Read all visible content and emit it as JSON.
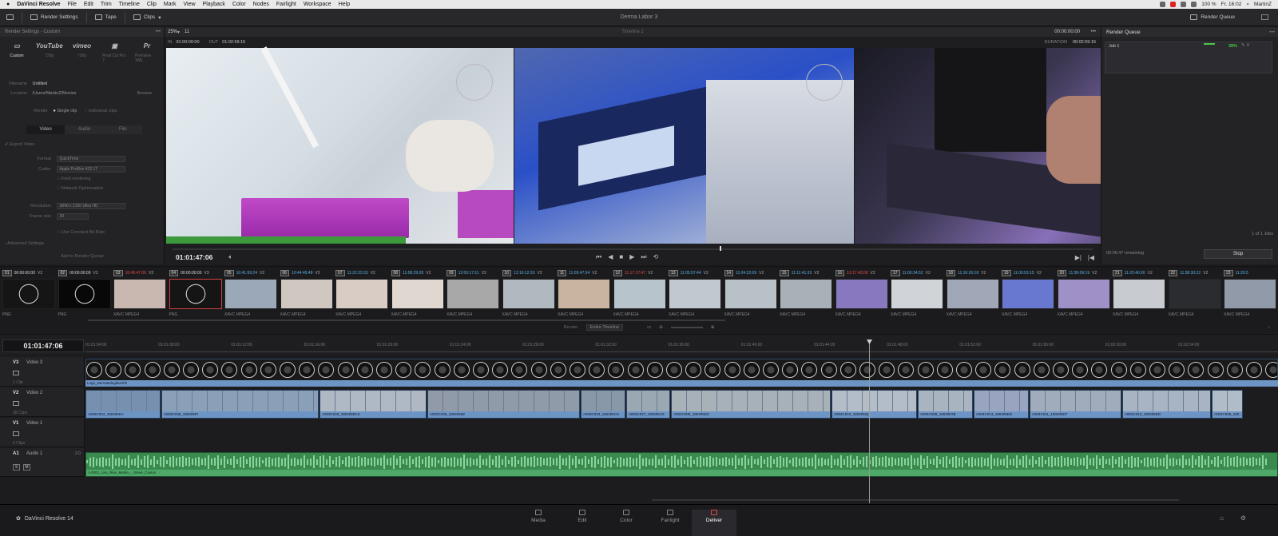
{
  "menubar": {
    "app": "DaVinci Resolve",
    "items": [
      "File",
      "Edit",
      "Trim",
      "Timeline",
      "Clip",
      "Mark",
      "View",
      "Playback",
      "Color",
      "Nodes",
      "Fairlight",
      "Workspace",
      "Help"
    ],
    "battery": "100 %",
    "clock": "Fr. 16:02",
    "user": "MartinZ"
  },
  "toolbar": {
    "render_settings": "Render Settings",
    "tape": "Tape",
    "clips": "Clips",
    "project_title": "Derma Labor 3",
    "render_queue": "Render Queue"
  },
  "render_settings": {
    "header": "Render Settings - Custom",
    "presets": [
      {
        "icon": "film-icon",
        "label": "Custom"
      },
      {
        "icon": "youtube-logo",
        "text": "YouTube",
        "label": "720p"
      },
      {
        "icon": "vimeo-logo",
        "text": "vimeo",
        "label": "720p"
      },
      {
        "icon": "clapper-icon",
        "label": "Final Cut Pro 7"
      },
      {
        "icon": "premiere-icon",
        "text": "Pr",
        "label": "Premiere XML"
      }
    ],
    "filename_label": "Filename",
    "filename": "Untitled",
    "location_label": "Location",
    "location": "/Users/MartinZ/Movies",
    "browse": "Browse",
    "render_label": "Render",
    "single_clip": "Single clip",
    "individual_clips": "Individual clips",
    "tabs": [
      "Video",
      "Audio",
      "File"
    ],
    "export_video": "Export Video",
    "format_label": "Format",
    "format": "QuickTime",
    "codec_label": "Codec",
    "codec": "Apple ProRes 422 LT",
    "field_rendering": "Field rendering",
    "network_opt": "Network Optimization",
    "resolution_label": "Resolution",
    "resolution": "3840 x 2160 Ultra HD",
    "framerate_label": "Frame rate",
    "framerate": "30",
    "bit_rate": "Use Constant Bit Rate",
    "advanced": "Advanced Settings",
    "add_queue": "Add to Render Queue"
  },
  "viewer": {
    "zoom": "25%",
    "clip_number": "11",
    "timeline_name": "Timeline 1",
    "header_tc": "00:00:00:00",
    "in_label": "IN",
    "in_tc": "01:00:00:00",
    "out_label": "OUT",
    "out_tc": "01:02:59:15",
    "duration_label": "DURATION",
    "duration": "00:02:59:16",
    "timecode": "01:01:47:06"
  },
  "render_queue": {
    "title": "Render Queue",
    "job": "Job 1",
    "progress_pct": "39%",
    "jobs_count": "1 of 1 Jobs",
    "remaining": "00:06:47 remaining",
    "stop": "Stop"
  },
  "clips": [
    {
      "num": "01",
      "tc": "00:00:00:00",
      "tc_color": "wh",
      "track": "V2",
      "codec": "PNG",
      "color": "#151515"
    },
    {
      "num": "02",
      "tc": "00:00:00:00",
      "tc_color": "wh",
      "track": "V2",
      "codec": "PNG",
      "color": "#080808"
    },
    {
      "num": "03",
      "tc": "10:45:47:06",
      "tc_color": "red",
      "track": "V2",
      "codec": "XAVC MPEG4",
      "color": "#c8b8b0"
    },
    {
      "num": "04",
      "tc": "00:00:00:00",
      "tc_color": "wh",
      "track": "V3",
      "codec": "PNG",
      "color": "#151515"
    },
    {
      "num": "05",
      "tc": "10:41:59:24",
      "tc_color": "bl",
      "track": "V2",
      "codec": "XAVC MPEG4",
      "color": "#9aa8b8"
    },
    {
      "num": "06",
      "tc": "10:44:49:48",
      "tc_color": "bl",
      "track": "V2",
      "codec": "XAVC MPEG4",
      "color": "#d0c8c0"
    },
    {
      "num": "07",
      "tc": "11:22:23:33",
      "tc_color": "bl",
      "track": "V2",
      "codec": "XAVC MPEG4",
      "color": "#d8ccc4"
    },
    {
      "num": "08",
      "tc": "11:58:29:28",
      "tc_color": "bl",
      "track": "V2",
      "codec": "XAVC MPEG4",
      "color": "#e0d8d0"
    },
    {
      "num": "09",
      "tc": "12:00:17:11",
      "tc_color": "bl",
      "track": "V2",
      "codec": "XAVC MPEG4",
      "color": "#a8a8a8"
    },
    {
      "num": "10",
      "tc": "12:16:12:33",
      "tc_color": "bl",
      "track": "V2",
      "codec": "XAVC MPEG4",
      "color": "#b0b8c0"
    },
    {
      "num": "11",
      "tc": "11:05:47:34",
      "tc_color": "bl",
      "track": "V2",
      "codec": "XAVC MPEG4",
      "color": "#c8b4a0"
    },
    {
      "num": "12",
      "tc": "11:17:17:47",
      "tc_color": "red",
      "track": "V2",
      "codec": "XAVC MPEG4",
      "color": "#b8c4cc"
    },
    {
      "num": "13",
      "tc": "11:05:57:44",
      "tc_color": "bl",
      "track": "V2",
      "codec": "XAVC MPEG4",
      "color": "#c0c8d0"
    },
    {
      "num": "14",
      "tc": "11:04:22:09",
      "tc_color": "bl",
      "track": "V2",
      "codec": "XAVC MPEG4",
      "color": "#b8c0c8"
    },
    {
      "num": "15",
      "tc": "11:11:41:33",
      "tc_color": "bl",
      "track": "V2",
      "codec": "XAVC MPEG4",
      "color": "#a8b0b8"
    },
    {
      "num": "16",
      "tc": "13:17:43:08",
      "tc_color": "red",
      "track": "V2",
      "codec": "XAVC MPEG4",
      "color": "#8878c0"
    },
    {
      "num": "17",
      "tc": "11:00:34:52",
      "tc_color": "bl",
      "track": "V2",
      "codec": "XAVC MPEG4",
      "color": "#d0d4d8"
    },
    {
      "num": "18",
      "tc": "11:16:26:18",
      "tc_color": "bl",
      "track": "V2",
      "codec": "XAVC MPEG4",
      "color": "#a0a8b8"
    },
    {
      "num": "19",
      "tc": "11:00:53:15",
      "tc_color": "bl",
      "track": "V2",
      "codec": "XAVC MPEG4",
      "color": "#6878d0"
    },
    {
      "num": "20",
      "tc": "11:38:09:19",
      "tc_color": "bl",
      "track": "V2",
      "codec": "XAVC MPEG4",
      "color": "#a090c8"
    },
    {
      "num": "21",
      "tc": "11:25:40:26",
      "tc_color": "bl",
      "track": "V2",
      "codec": "XAVC MPEG4",
      "color": "#c8ccd0"
    },
    {
      "num": "22",
      "tc": "11:38:30:22",
      "tc_color": "bl",
      "track": "V2",
      "codec": "XAVC MPEG4",
      "color": "#2a2c30"
    },
    {
      "num": "23",
      "tc": "11:29:5",
      "tc_color": "bl",
      "track": "",
      "codec": "XAVC MPEG4",
      "color": "#909aa8"
    }
  ],
  "timeline_bar": {
    "render_label": "Render",
    "render_value": "Entire Timeline"
  },
  "timeline": {
    "timecode": "01:01:47:06",
    "ticks": [
      "01:01:04:00",
      "01:01:08:00",
      "01:01:12:00",
      "01:01:16:00",
      "01:01:20:00",
      "01:01:24:00",
      "01:01:28:00",
      "01:01:32:00",
      "01:01:36:00",
      "01:01:40:00",
      "01:01:44:00",
      "01:01:48:00",
      "01:01:52:00",
      "01:01:56:00",
      "01:02:00:00",
      "01:02:04:00"
    ],
    "tracks": [
      {
        "id": "V3",
        "name": "Video 3",
        "count": "1 Clip"
      },
      {
        "id": "V2",
        "name": "Video 2",
        "count": "38 Clips"
      },
      {
        "id": "V1",
        "name": "Video 1",
        "count": "0 Clips"
      },
      {
        "id": "A1",
        "name": "Audio 1",
        "level": "2.0",
        "s": "S",
        "m": "M"
      }
    ],
    "v3_clip_label": "Logo_Dermatologikumhh",
    "v2_clips": [
      {
        "label": "A003C034_180405KA",
        "w": 95,
        "color": "#7890b0"
      },
      {
        "label": "A003C038_180405PI",
        "w": 198,
        "color": "#8aa0b8"
      },
      {
        "label": "A003C025_1804059CS",
        "w": 135,
        "color": "#b0b8c4"
      },
      {
        "label": "A003C036_1804059Z",
        "w": 192,
        "color": "#909aa8"
      },
      {
        "label": "A003C023_180405CS",
        "w": 57,
        "color": "#8898a8"
      },
      {
        "label": "A003C027_180405VS",
        "w": 56,
        "color": "#9aa8b4"
      },
      {
        "label": "A004C008_180405DX",
        "w": 201,
        "color": "#a8b0b8"
      },
      {
        "label": "A004C010_180405IQ",
        "w": 108,
        "color": "#b4bcc8"
      },
      {
        "label": "A004C009_180405TB",
        "w": 70,
        "color": "#a8b4c0"
      },
      {
        "label": "A004C013_180405ED",
        "w": 70,
        "color": "#98a4c0"
      },
      {
        "label": "A004C011_180405D7",
        "w": 116,
        "color": "#a0acbc"
      },
      {
        "label": "A004C013_180405ED",
        "w": 112,
        "color": "#a8b4c4"
      },
      {
        "label": "A004C005_180...",
        "w": 40,
        "color": "#b0bcc8"
      }
    ],
    "a1_clip_label": "1-0002_Liss_Rise_Media_-_Steve_Cuvius"
  },
  "pages": [
    {
      "label": "Media",
      "icon": "media-icon"
    },
    {
      "label": "Edit",
      "icon": "edit-icon"
    },
    {
      "label": "Color",
      "icon": "color-icon"
    },
    {
      "label": "Fairlight",
      "icon": "fairlight-icon"
    },
    {
      "label": "Deliver",
      "icon": "deliver-icon",
      "active": true
    }
  ],
  "footer": {
    "app_name": "DaVinci Resolve 14"
  }
}
